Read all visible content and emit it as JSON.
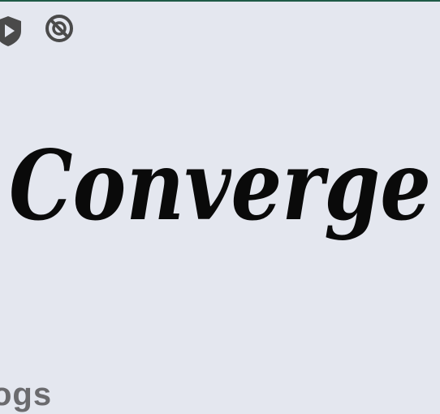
{
  "status_bar": {
    "icons": [
      "shield-play-icon",
      "no-entry-icon"
    ]
  },
  "logo": {
    "text": "Converge"
  },
  "bottom_label": {
    "text": "ogs"
  },
  "colors": {
    "background": "#e4e7ef",
    "top_border": "#1e5a46",
    "logo_text": "#0a0a0a",
    "icon_gray": "#4a4a4a",
    "label_gray": "#6b6b6e"
  }
}
